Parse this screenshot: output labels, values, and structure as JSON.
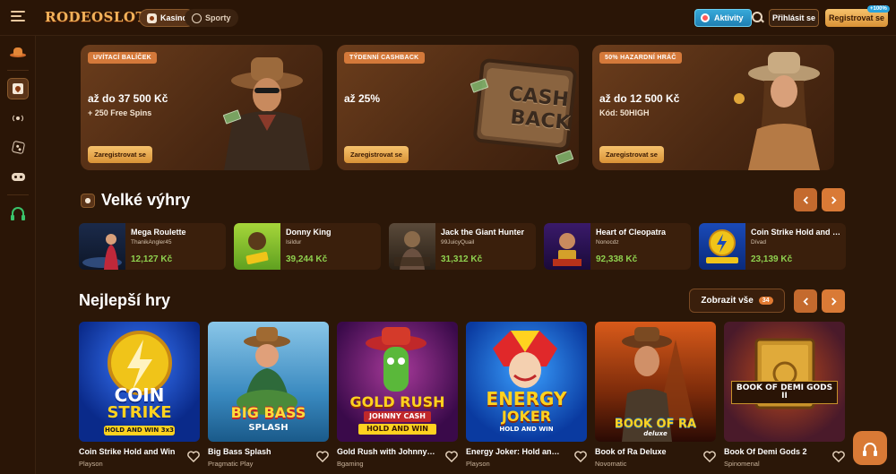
{
  "header": {
    "logo": "RODEOSLOT",
    "tabs": [
      {
        "label": "Kasino",
        "icon": "cards-icon",
        "active": true
      },
      {
        "label": "Sporty",
        "icon": "ball-icon",
        "active": false
      }
    ],
    "activity_label": "Aktivity",
    "login_label": "Přihlásit se",
    "register_label": "Registrovat se",
    "register_badge": "+100%"
  },
  "sidebar": {
    "items": [
      "cowboy-hat-icon",
      "cards-icon",
      "live-icon",
      "dice-icon",
      "gamepad-icon",
      "headset-icon"
    ]
  },
  "promos": [
    {
      "tag": "UVÍTACÍ BALÍČEK",
      "title": "až do 37 500 Kč",
      "sub": "+ 250 Free Spins",
      "button": "Zaregistrovat se"
    },
    {
      "tag": "TÝDENNÍ CASHBACK",
      "title": "až 25%",
      "sub": "",
      "button": "Zaregistrovat se",
      "art_text_1": "CASH",
      "art_text_2": "BACK"
    },
    {
      "tag": "50% HAZARDNÍ HRÁČ",
      "title": "až do 12 500 Kč",
      "sub": "Kód: 50HIGH",
      "button": "Zaregistrovat se"
    }
  ],
  "big_wins": {
    "title": "Velké výhry",
    "items": [
      {
        "game": "Mega Roulette",
        "user": "ThanikAngler45",
        "amount": "12,127 Kč"
      },
      {
        "game": "Donny King",
        "user": "Isildur",
        "amount": "39,244 Kč"
      },
      {
        "game": "Jack the Giant Hunter",
        "user": "99JuicyQuail",
        "amount": "31,312 Kč"
      },
      {
        "game": "Heart of Cleopatra",
        "user": "Nonocdz",
        "amount": "92,338 Kč"
      },
      {
        "game": "Coin Strike Hold and Win",
        "user": "Dívad",
        "amount": "23,139 Kč"
      }
    ]
  },
  "top_games": {
    "title": "Nejlepší hry",
    "view_all": "Zobrazit vše",
    "count": "34",
    "items": [
      {
        "name": "Coin Strike Hold and Win",
        "provider": "Playson",
        "art_1": "COIN",
        "art_2": "STRIKE",
        "art_3": "HOLD AND WIN 3x3"
      },
      {
        "name": "Big Bass Splash",
        "provider": "Pragmatic Play",
        "art_1": "BIG BASS",
        "art_2": "SPLASH",
        "art_3": ""
      },
      {
        "name": "Gold Rush with Johnny Cash",
        "provider": "Bgaming",
        "art_1": "GOLD RUSH",
        "art_2": "JOHNNY CASH",
        "art_3": "HOLD AND WIN"
      },
      {
        "name": "Energy Joker: Hold and Win",
        "provider": "Playson",
        "art_1": "ENERGY",
        "art_2": "JOKER",
        "art_3": "HOLD AND WIN"
      },
      {
        "name": "Book of Ra Deluxe",
        "provider": "Novomatic",
        "art_1": "BOOK OF RA",
        "art_2": "deluxe",
        "art_3": ""
      },
      {
        "name": "Book Of Demi Gods 2",
        "provider": "Spinomenal",
        "art_1": "BOOK OF DEMI GODS II",
        "art_2": "",
        "art_3": ""
      }
    ]
  },
  "colors": {
    "background": "#2b1708",
    "accent": "#d97a36",
    "gold": "#f6c26c",
    "win_green": "#8fd14f"
  }
}
